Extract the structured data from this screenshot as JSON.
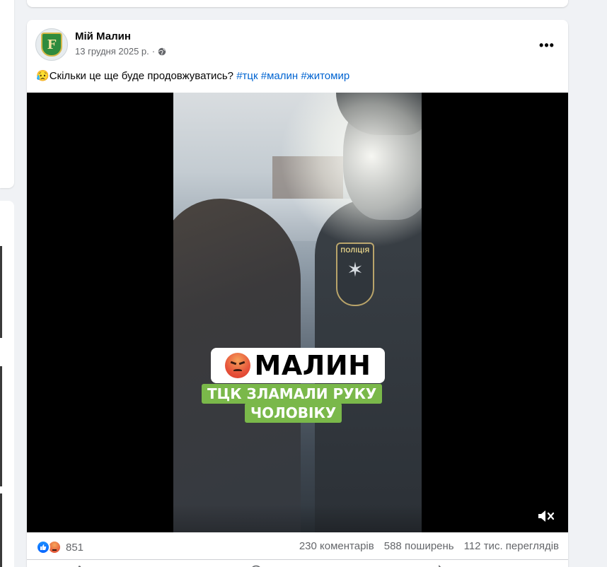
{
  "post": {
    "page_name": "Мій Малин",
    "date": "13 грудня 2025 р.",
    "separator": "·",
    "avatar_letter": "F",
    "more_label": "•••",
    "text_emoji": "😥",
    "text": "Скільки це ще буде продовжуватись?",
    "hashtags": [
      "#тцк",
      "#малин",
      "#житомир"
    ]
  },
  "video": {
    "caption_title": "МАЛИН",
    "caption_line1": "ТЦК ЗЛАМАЛИ РУКУ",
    "caption_line2": "ЧОЛОВІКУ",
    "patch_label": "ПОЛІЦІЯ",
    "muted": true
  },
  "engagement": {
    "reaction_count": "851",
    "comments": "230 коментарів",
    "shares": "588 поширень",
    "views": "112 тис. переглядів",
    "reaction_icons": [
      "like-icon",
      "angry-icon"
    ]
  },
  "colors": {
    "hashtag": "#0064d1",
    "caption_green": "#7ab84a",
    "like_blue": "#0866ff"
  }
}
